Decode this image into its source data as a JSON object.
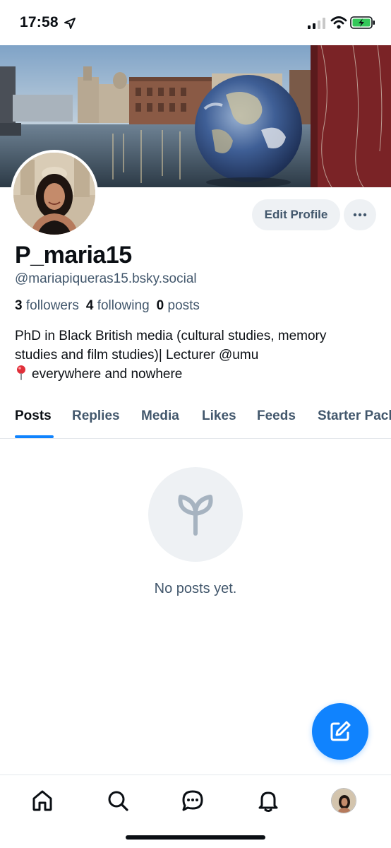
{
  "status_bar": {
    "time": "17:58"
  },
  "profile": {
    "display_name": "P_maria15",
    "handle": "@mariapiqueras15.bsky.social",
    "stats": {
      "followers_count": "3",
      "followers_label": "followers",
      "following_count": "4",
      "following_label": "following",
      "posts_count": "0",
      "posts_label": "posts"
    },
    "bio": {
      "line1": "PhD in Black British media (cultural studies, memory",
      "line2": "studies and film studies)| Lecturer @umu",
      "line3": "everywhere and nowhere"
    },
    "edit_profile_label": "Edit Profile",
    "more_label": "···"
  },
  "tabs": [
    {
      "label": "Posts",
      "active": true
    },
    {
      "label": "Replies",
      "active": false
    },
    {
      "label": "Media",
      "active": false
    },
    {
      "label": "Likes",
      "active": false
    },
    {
      "label": "Feeds",
      "active": false
    },
    {
      "label": "Starter Packs",
      "active": false
    }
  ],
  "empty_state": {
    "text": "No posts yet.",
    "icon": "sprout-icon"
  },
  "fab": {
    "icon": "compose-icon"
  },
  "bottom_nav": [
    {
      "icon": "home-icon"
    },
    {
      "icon": "search-icon"
    },
    {
      "icon": "chat-icon"
    },
    {
      "icon": "bell-icon"
    },
    {
      "icon": "profile-avatar"
    }
  ],
  "colors": {
    "accent": "#1083fe",
    "text_primary": "#0b0f14",
    "text_secondary": "#42576c",
    "button_bg": "#eef1f4"
  }
}
